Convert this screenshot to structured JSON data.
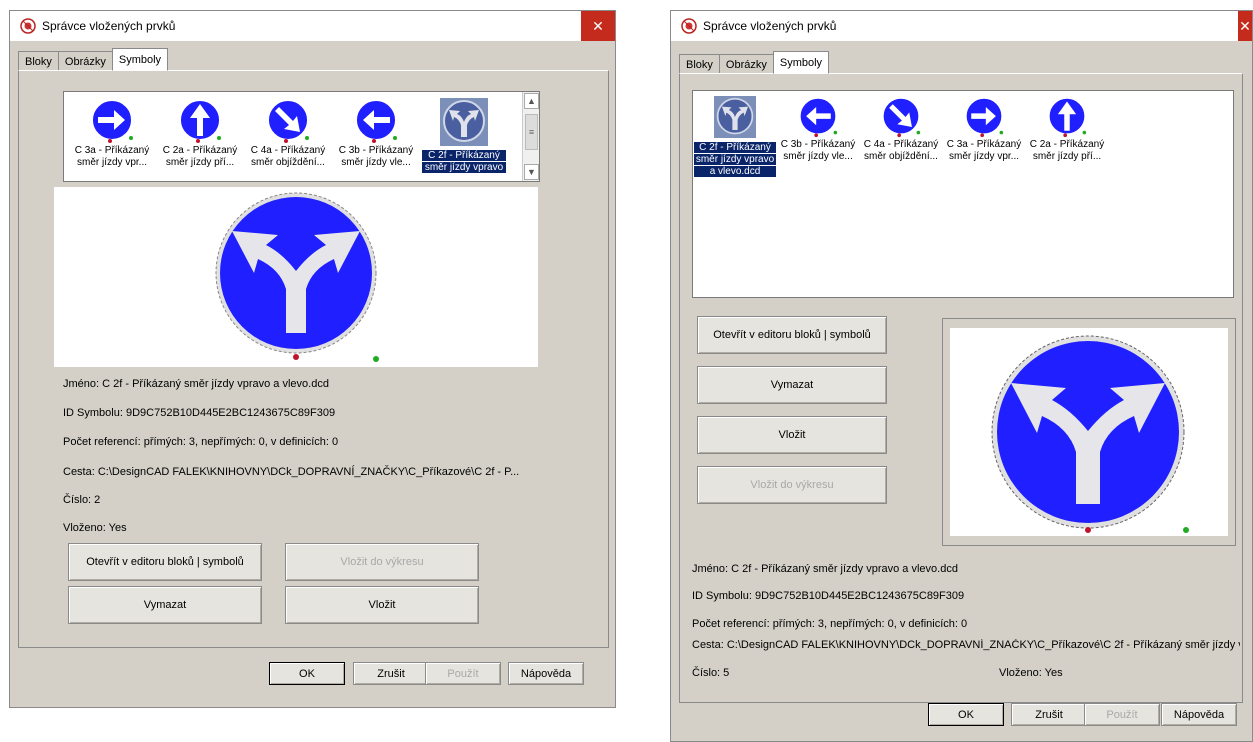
{
  "colors": {
    "sign_blue": "#1f1fff",
    "arrow_gray": "#e6e6ea",
    "selection": "#0a246a",
    "close_red": "#c42b1c",
    "dot_red": "#c0122b",
    "dot_green": "#22aa22"
  },
  "left": {
    "title": "Správce vložených prvků",
    "tabs": [
      "Bloky",
      "Obrázky",
      "Symboly"
    ],
    "thumbnails": [
      {
        "icon": "arrow-right-sign",
        "line1": "C 3a - Příkázaný",
        "line2": "směr jízdy vpr..."
      },
      {
        "icon": "arrow-up-sign",
        "line1": "C 2a - Příkázaný",
        "line2": "směr jízdy pří..."
      },
      {
        "icon": "arrow-diagonal-sign",
        "line1": "C 4a - Příkázaný",
        "line2": "směr objíždění..."
      },
      {
        "icon": "arrow-left-sign",
        "line1": "C 3b - Příkázaný",
        "line2": "směr jízdy vle..."
      },
      {
        "icon": "arrow-fork-sign",
        "line1": "C 2f - Příkázaný",
        "line2": "směr jízdy vpravo",
        "selected": true
      }
    ],
    "info": {
      "name": "Jméno: C 2f - Příkázaný směr jízdy vpravo a vlevo.dcd",
      "id": "ID Symbolu: 9D9C752B10D445E2BC1243675C89F309",
      "refs": "Počet referencí: přímých: 3, nepřímých: 0, v definicích: 0",
      "path": "Cesta: C:\\DesignCAD FALEK\\KNIHOVNY\\DCk_DOPRAVNÍ_ZNAČKY\\C_Příkazové\\C 2f - P...",
      "number": "Číslo: 2",
      "inserted": "Vloženo: Yes"
    },
    "buttons": {
      "open_editor": "Otevřít v editoru bloků | symbolů",
      "insert_drawing": "Vložit do výkresu",
      "delete": "Vymazat",
      "insert": "Vložit"
    },
    "dialog": {
      "ok": "OK",
      "cancel": "Zrušit",
      "apply": "Použít",
      "help": "Nápověda"
    }
  },
  "right": {
    "title": "Správce vložených prvků",
    "tabs": [
      "Bloky",
      "Obrázky",
      "Symboly"
    ],
    "thumbnails": [
      {
        "icon": "arrow-fork-sign",
        "line1": "C 2f - Příkázaný",
        "line2": "směr jízdy vpravo",
        "line3": "a vlevo.dcd",
        "selected": true
      },
      {
        "icon": "arrow-left-sign",
        "line1": "C 3b - Příkázaný",
        "line2": "směr jízdy vle..."
      },
      {
        "icon": "arrow-diagonal-sign",
        "line1": "C 4a - Příkázaný",
        "line2": "směr objíždění..."
      },
      {
        "icon": "arrow-right-sign",
        "line1": "C 3a - Příkázaný",
        "line2": "směr jízdy vpr..."
      },
      {
        "icon": "arrow-up-sign",
        "line1": "C 2a - Příkázaný",
        "line2": "směr jízdy pří..."
      }
    ],
    "info": {
      "name": "Jméno: C 2f - Příkázaný směr jízdy vpravo a vlevo.dcd",
      "id": "ID Symbolu: 9D9C752B10D445E2BC1243675C89F309",
      "refs": "Počet referencí: přímých: 3, nepřímých: 0, v definicích: 0",
      "path": "Cesta: C:\\DesignCAD FALEK\\KNIHOVNY\\DCk_DOPRAVNÍ_ZNAČKY\\C_Příkazové\\C 2f - Příkázaný směr jízdy vpravo",
      "number": "Číslo: 5",
      "inserted": "Vloženo: Yes"
    },
    "buttons": {
      "open_editor": "Otevřít v editoru bloků | symbolů",
      "delete": "Vymazat",
      "insert": "Vložit",
      "insert_drawing": "Vložit do výkresu"
    },
    "dialog": {
      "ok": "OK",
      "cancel": "Zrušit",
      "apply": "Použít",
      "help": "Nápověda"
    }
  }
}
